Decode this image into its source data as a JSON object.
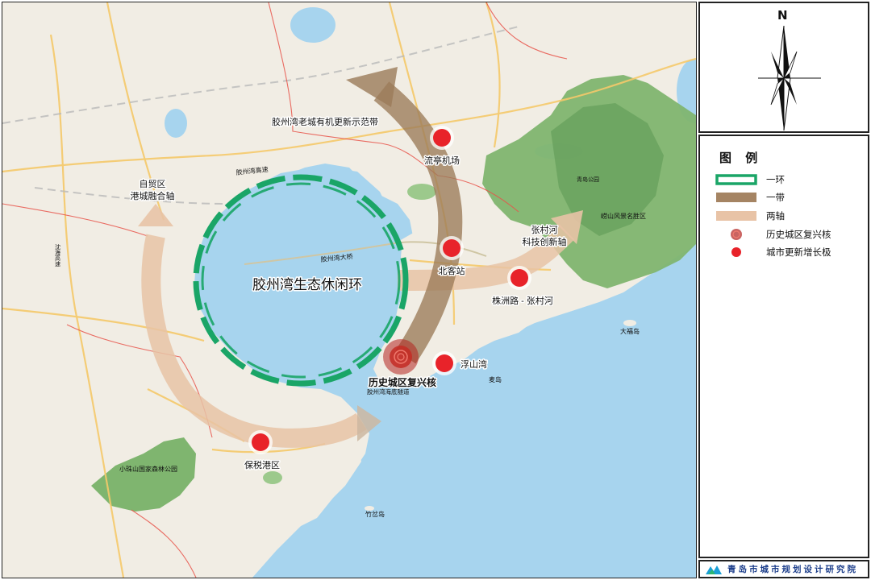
{
  "map": {
    "ring_label": "胶州湾生态休闲环",
    "labels": {
      "old_city_demo_belt": "胶州湾老城有机更新示范带",
      "ftz_line1": "自贸区",
      "ftz_line2": "港城融合轴",
      "zhangcunhe_line1": "张村河",
      "zhangcunhe_line2": "科技创新轴",
      "historic_core": "历史城区复兴核"
    },
    "nodes": [
      {
        "id": "liuting",
        "label": "流亭机场"
      },
      {
        "id": "north_station",
        "label": "北客站"
      },
      {
        "id": "zhuzhou",
        "label": "株洲路 - 张村河"
      },
      {
        "id": "fushanwan",
        "label": "浮山湾"
      },
      {
        "id": "bonded_port",
        "label": "保税港区"
      }
    ],
    "base_labels": {
      "expressway": "胶州湾高速",
      "bridge": "胶州湾大桥",
      "tunnel": "胶州湾海底隧道",
      "laoshan": "崂山风景名胜区",
      "xiaozhushan": "小珠山国家森林公园",
      "damaidao": "麦岛",
      "dafudao": "大福岛",
      "zhuchadao": "竹岔岛",
      "shenhai": "沈海高速",
      "huanghe": "青岛公园"
    }
  },
  "compass": {
    "north_letter": "N"
  },
  "legend": {
    "title": "图 例",
    "items": [
      {
        "label": "一环",
        "symbol": "green-dashed-ring"
      },
      {
        "label": "一带",
        "symbol": "brown-band"
      },
      {
        "label": "两轴",
        "symbol": "tan-axis"
      },
      {
        "label": "历史城区复兴核",
        "symbol": "dark-red-core"
      },
      {
        "label": "城市更新增长极",
        "symbol": "red-growth-pole"
      }
    ]
  },
  "footer": {
    "institute": "青岛市城市规划设计研究院"
  },
  "colors": {
    "sea": "#a7d4ee",
    "land": "#f1ede4",
    "ring": "#1aa567",
    "band": "#9b7b59",
    "axis": "#e8c3a6",
    "node": "#e8232a",
    "core": "#b2221f",
    "mountain": "#79b06b",
    "boundary": "#e8534a",
    "road": "#f5c96a"
  }
}
